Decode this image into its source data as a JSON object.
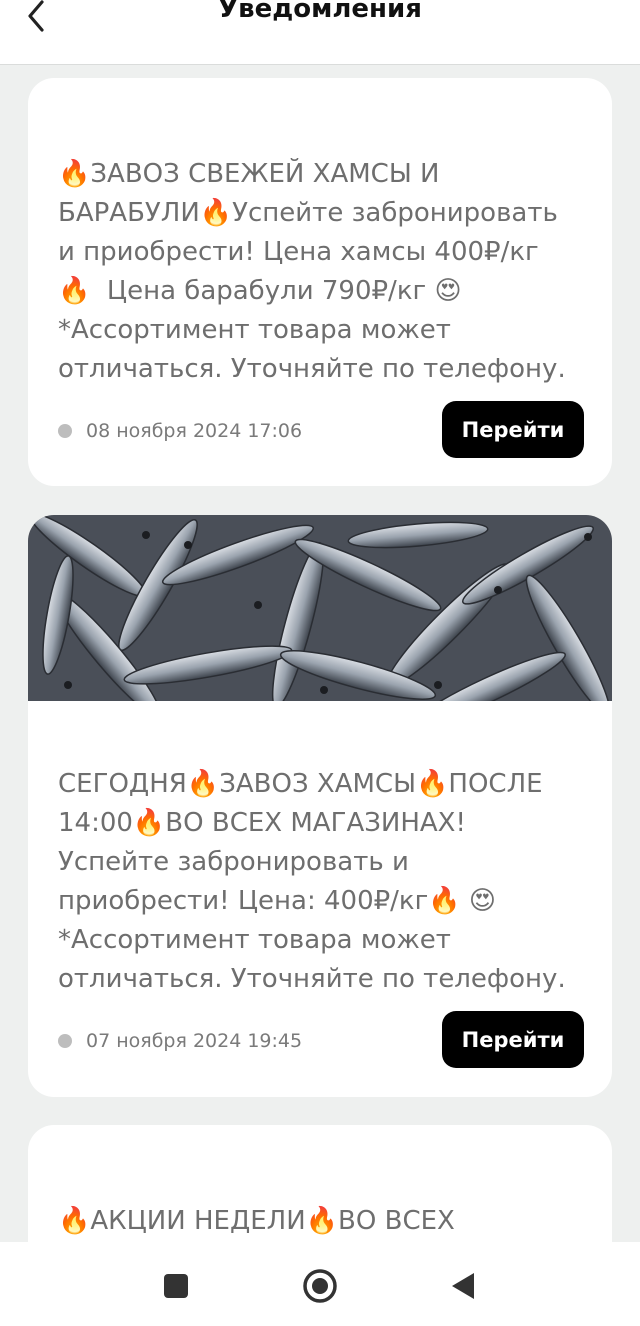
{
  "header": {
    "title": "Уведомления",
    "back_icon": "chevron-left-icon"
  },
  "notifications": [
    {
      "text": "🔥ЗАВОЗ СВЕЖЕЙ ХАМСЫ И\nБАРАБУЛИ🔥Успейте забронировать\nи приобрести! Цена хамсы 400₽/кг\n🔥  Цена барабули 790₽/кг 😍\n*Ассортимент товара может\nотличаться. Уточняйте по телефону.",
      "date": "08 ноября 2024 17:06",
      "button_label": "Перейти",
      "has_image": false
    },
    {
      "text": "СЕГОДНЯ🔥ЗАВОЗ ХАМСЫ🔥ПОСЛЕ\n14:00🔥ВО ВСЕХ МАГАЗИНАХ!\nУспейте забронировать и\nприобрести! Цена: 400₽/кг🔥 😍\n*Ассортимент товара может\nотличаться. Уточняйте по телефону.",
      "date": "07 ноября 2024 19:45",
      "button_label": "Перейти",
      "has_image": true,
      "image_subject": "pile of fresh anchovies"
    },
    {
      "text": "🔥АКЦИИ НЕДЕЛИ🔥ВО ВСЕХ",
      "has_image": false
    }
  ],
  "bottom_nav": {
    "items": [
      "recent-apps-icon",
      "home-icon",
      "back-triangle-icon"
    ]
  },
  "colors": {
    "background": "#eef0ef",
    "card": "#ffffff",
    "button": "#000000",
    "button_text": "#ffffff",
    "body_text": "#6e6e6e"
  }
}
